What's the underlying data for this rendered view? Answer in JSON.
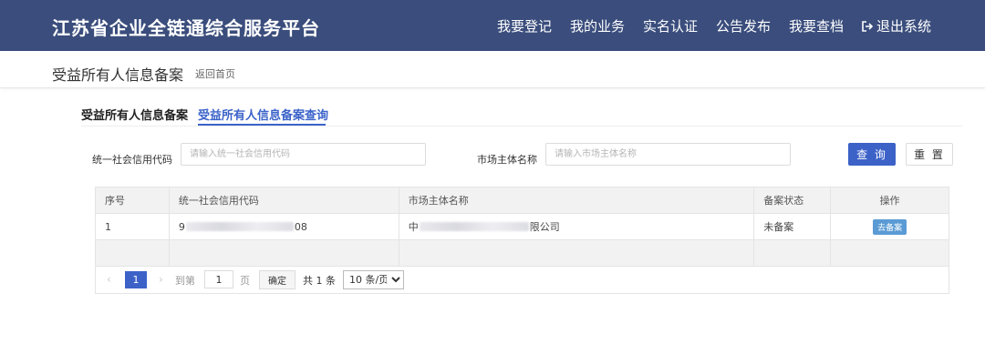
{
  "header": {
    "logo": "江苏省企业全链通综合服务平台",
    "nav": [
      {
        "label": "我要登记"
      },
      {
        "label": "我的业务"
      },
      {
        "label": "实名认证"
      },
      {
        "label": "公告发布"
      },
      {
        "label": "我要查档"
      },
      {
        "label": "退出系统",
        "icon": "logout-icon"
      }
    ]
  },
  "breadcrumb": {
    "title": "受益所有人信息备案",
    "back": "返回首页"
  },
  "tabs": [
    {
      "label": "受益所有人信息备案",
      "active": false
    },
    {
      "label": "受益所有人信息备案查询",
      "active": true
    }
  ],
  "search": {
    "credit_code_label": "统一社会信用代码",
    "credit_code_placeholder": "请输入统一社会信用代码",
    "credit_code_value": "",
    "entity_name_label": "市场主体名称",
    "entity_name_placeholder": "请输入市场主体名称",
    "entity_name_value": "",
    "query_button": "查 询",
    "reset_button": "重 置"
  },
  "table": {
    "columns": [
      "序号",
      "统一社会信用代码",
      "市场主体名称",
      "备案状态",
      "操作"
    ],
    "rows": [
      {
        "index": "1",
        "credit_code_start": "9",
        "credit_code_end": "08",
        "name_start": "中",
        "name_end": "限公司",
        "status": "未备案",
        "action": "去备案"
      }
    ]
  },
  "pagination": {
    "prev": "‹",
    "current_page": "1",
    "next": "›",
    "goto_label": "到第",
    "goto_value": "1",
    "page_unit": "页",
    "confirm": "确定",
    "total": "共 1 条",
    "page_size": "10 条/页"
  },
  "colors": {
    "header_bg": "#3a4d7c",
    "accent": "#3c62c8",
    "action_button": "#5b9bd5"
  }
}
